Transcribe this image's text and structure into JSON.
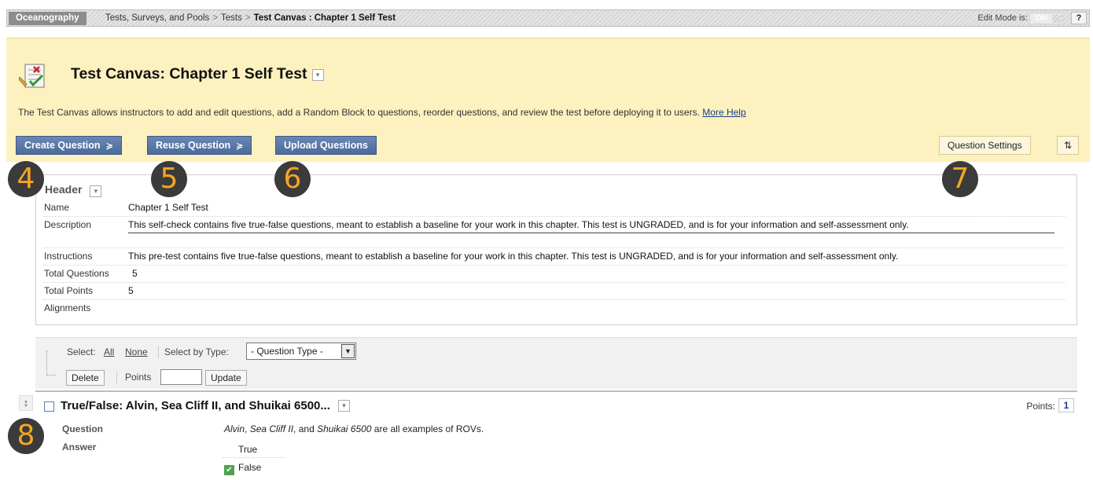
{
  "topbar": {
    "course": "Oceanography",
    "breadcrumbs": [
      "Tests, Surveys, and Pools",
      "Tests"
    ],
    "current": "Test Canvas : Chapter 1 Self Test",
    "edit_mode_label": "Edit Mode is:",
    "edit_mode_state": "ON",
    "help": "?"
  },
  "page": {
    "title": "Test Canvas: Chapter 1 Self Test",
    "description": "The Test Canvas allows instructors to add and edit questions, add a Random Block to questions, reorder questions, and review the test before deploying it to users.",
    "more_help": "More Help"
  },
  "actions": {
    "create_question": "Create Question",
    "reuse_question": "Reuse Question",
    "upload_questions": "Upload Questions",
    "question_settings": "Question Settings",
    "sort_icon": "⇅"
  },
  "markers": [
    "4",
    "5",
    "6",
    "7",
    "8"
  ],
  "header_info": {
    "title": "Header",
    "rows": [
      {
        "key": "Name",
        "value": "Chapter 1 Self Test"
      },
      {
        "key": "Description",
        "value": "This self-check contains five true-false questions, meant to establish a baseline for your work in this chapter. This test is UNGRADED, and is for your information and self-assessment only."
      },
      {
        "key": "Instructions",
        "value": "This pre-test contains five true-false questions, meant to establish a baseline for your work in this chapter. This test is UNGRADED, and is for your information and self-assessment only."
      },
      {
        "key": "Total Questions",
        "value": "5"
      },
      {
        "key": "Total Points",
        "value": "5"
      },
      {
        "key": "Alignments",
        "value": ""
      }
    ]
  },
  "toolbar": {
    "select_label": "Select:",
    "all": "All",
    "none": "None",
    "select_by_type": "Select by Type:",
    "question_type": "- Question Type -",
    "delete": "Delete",
    "points": "Points",
    "update": "Update"
  },
  "question": {
    "title": "True/False: Alvin, Sea Cliff II, and Shuikai 6500...",
    "points_label": "Points:",
    "points_value": "1",
    "question_label": "Question",
    "question_parts": [
      "Alvin",
      ", ",
      "Sea Cliff II",
      ", and ",
      "Shuikai 6500",
      " are all examples of ROVs."
    ],
    "answer_label": "Answer",
    "answers": [
      "True",
      "False"
    ],
    "correct_answer": "False"
  }
}
